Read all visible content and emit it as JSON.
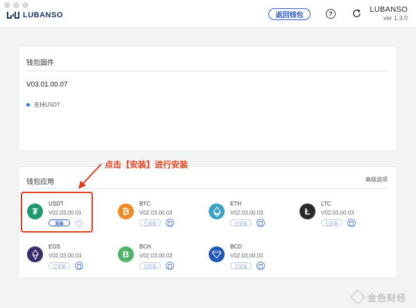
{
  "header": {
    "logo_text": "LUBANSO",
    "back_wallet_label": "返回钱包",
    "help_label": "?",
    "brand_name": "LUBANSO",
    "version": "ver 1.3.0"
  },
  "firmware": {
    "title": "钱包固件",
    "version": "V03.01.00.07",
    "support_text": "支持USDT"
  },
  "apps_section": {
    "title": "钱包应用",
    "advanced_label": "高级选项",
    "apps": [
      {
        "name": "USDT",
        "version": "V02.03.00.01",
        "status": "安装",
        "color": "#1e9a6e",
        "symbol": "₮"
      },
      {
        "name": "BTC",
        "version": "V02.03.00.03",
        "status": "已安装",
        "color": "#f08a24",
        "symbol": "₿"
      },
      {
        "name": "ETH",
        "version": "V02.03.00.03",
        "status": "已安装",
        "color": "#3aa3c4",
        "symbol": "⧫"
      },
      {
        "name": "LTC",
        "version": "V02.03.00.03",
        "status": "已安装",
        "color": "#2b2b2b",
        "symbol": "Ł"
      },
      {
        "name": "EOS",
        "version": "V02.03.00.03",
        "status": "已安装",
        "color": "#3b2c6b",
        "symbol": ""
      },
      {
        "name": "BCH",
        "version": "V02.03.00.03",
        "status": "已安装",
        "color": "#4fb46a",
        "symbol": "B"
      },
      {
        "name": "BCD",
        "version": "V02.03.00.03",
        "status": "已安装",
        "color": "#2057b8",
        "symbol": ""
      }
    ]
  },
  "annotation": {
    "text": "点击【安装】进行安装"
  },
  "watermark": {
    "text": "金色财经"
  }
}
